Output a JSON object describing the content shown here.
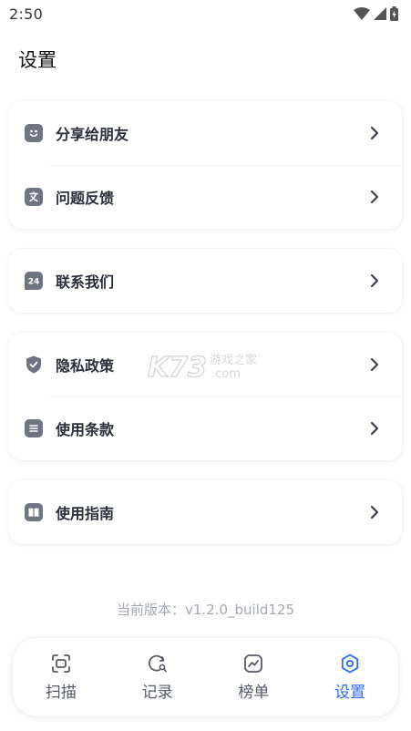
{
  "status_bar": {
    "time": "2:50"
  },
  "page": {
    "title": "设置"
  },
  "groups": [
    {
      "items": [
        {
          "label": "分享给朋友",
          "icon": "smile-icon"
        },
        {
          "label": "问题反馈",
          "icon": "translate-icon"
        }
      ]
    },
    {
      "items": [
        {
          "label": "联系我们",
          "icon": "support-24h-icon"
        }
      ]
    },
    {
      "items": [
        {
          "label": "隐私政策",
          "icon": "shield-check-icon"
        },
        {
          "label": "使用条款",
          "icon": "document-lines-icon"
        }
      ]
    },
    {
      "items": [
        {
          "label": "使用指南",
          "icon": "book-icon"
        }
      ]
    }
  ],
  "version_text": "当前版本：v1.2.0_build125",
  "watermark": {
    "brand": "K73",
    "line1": "游戏之家",
    "line2": ".com"
  },
  "tabbar": {
    "active_index": 3,
    "tabs": [
      {
        "label": "扫描",
        "icon": "scan-icon"
      },
      {
        "label": "记录",
        "icon": "history-search-icon"
      },
      {
        "label": "榜单",
        "icon": "trend-chart-icon"
      },
      {
        "label": "设置",
        "icon": "settings-icon"
      }
    ]
  },
  "colors": {
    "accent": "#2f6df6",
    "icon_gray": "#6e7482",
    "text": "#2a2f3a",
    "muted": "#a4a8b0"
  }
}
